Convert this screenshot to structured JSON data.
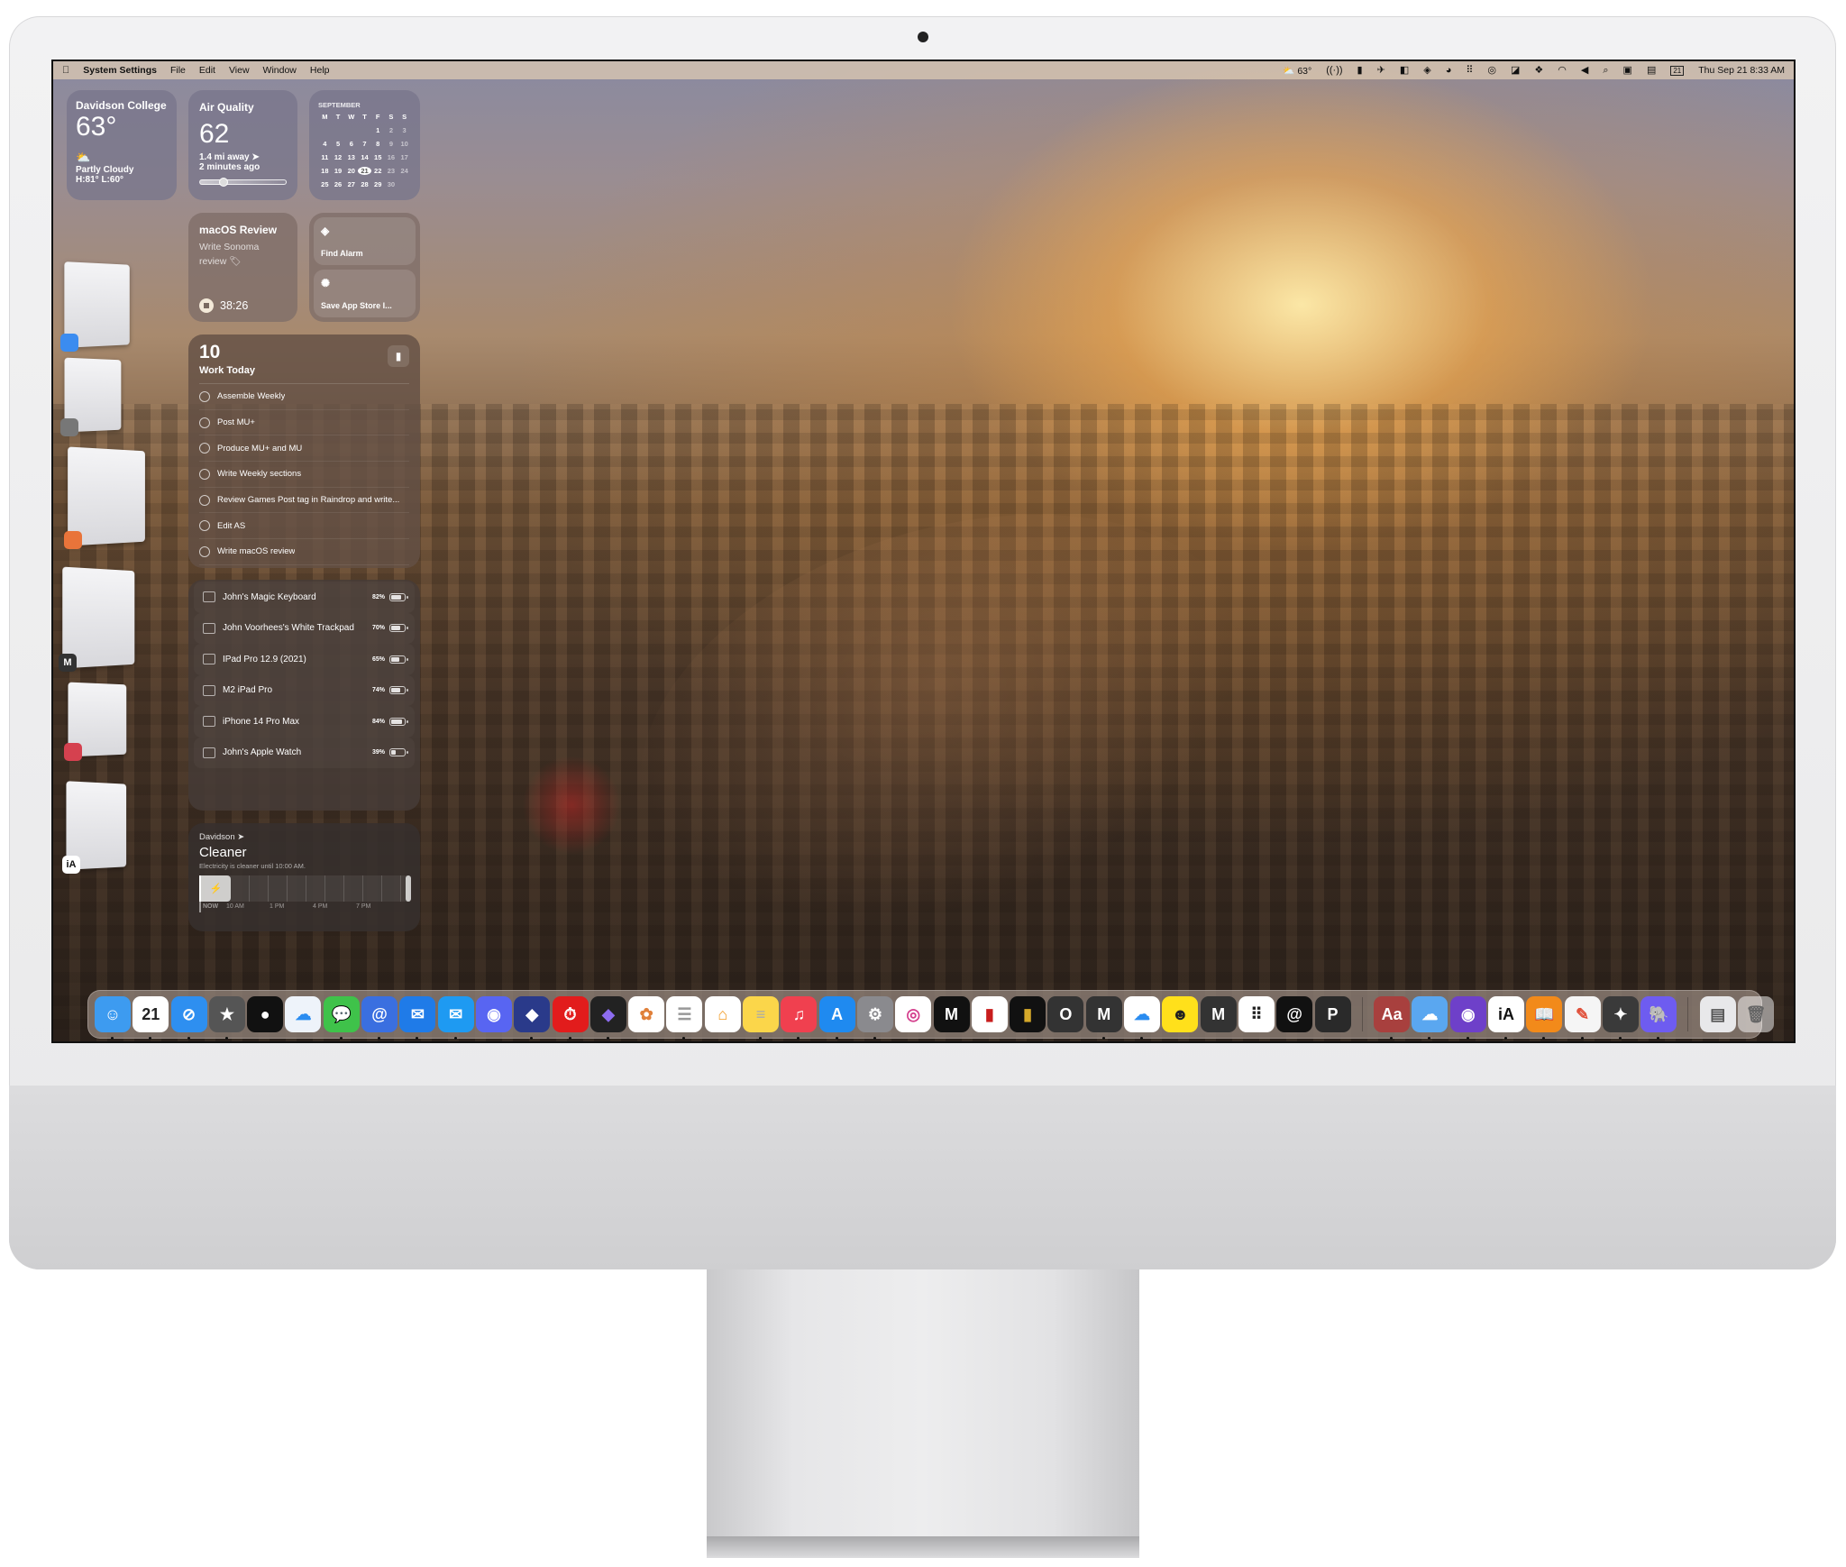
{
  "menubar": {
    "app_name": "System Settings",
    "menus": [
      "File",
      "Edit",
      "View",
      "Window",
      "Help"
    ],
    "status_icons": [
      "broadcast-icon",
      "weather-icon",
      "bookmark-icon",
      "rocket-icon",
      "sidebar-icon",
      "calendar-icon",
      "layers-icon",
      "pacman-icon",
      "grid-icon",
      "fingerprint-icon",
      "tag-icon",
      "dropbox-icon",
      "wifi-icon",
      "volume-icon",
      "search-icon",
      "control-center-icon",
      "display-icon"
    ],
    "weather_temp": "63°",
    "calendar_day": "21",
    "datetime": "Thu Sep 21  8:33 AM"
  },
  "weather": {
    "location": "Davidson College",
    "temp": "63°",
    "condition": "Partly Cloudy",
    "range": "H:81° L:60°"
  },
  "air_quality": {
    "title": "Air Quality",
    "value": "62",
    "distance": "1.4 mi away",
    "updated": "2 minutes ago",
    "level": 0.22
  },
  "calendar": {
    "month": "SEPTEMBER",
    "weekdays": [
      "M",
      "T",
      "W",
      "T",
      "F",
      "S",
      "S"
    ],
    "weeks": [
      [
        "",
        "",
        "",
        "",
        "1",
        "2",
        "3"
      ],
      [
        "4",
        "5",
        "6",
        "7",
        "8",
        "9",
        "10"
      ],
      [
        "11",
        "12",
        "13",
        "14",
        "15",
        "16",
        "17"
      ],
      [
        "18",
        "19",
        "20",
        "21",
        "22",
        "23",
        "24"
      ],
      [
        "25",
        "26",
        "27",
        "28",
        "29",
        "30",
        ""
      ]
    ],
    "today": "21"
  },
  "timer": {
    "title": "macOS Review",
    "subtitle": "Write Sonoma review",
    "elapsed": "38:26"
  },
  "shortcuts": [
    {
      "label": "Find Alarm",
      "icon": "layers-icon"
    },
    {
      "label": "Save App Store I...",
      "icon": "gear-icon"
    }
  ],
  "reminders": {
    "count": "10",
    "list": "Work Today",
    "items": [
      "Assemble Weekly",
      "Post MU+",
      "Produce MU+ and MU",
      "Write Weekly sections",
      "Review Games Post tag in Raindrop and write...",
      "Edit AS",
      "Write macOS review"
    ]
  },
  "batteries": [
    {
      "name": "John's Magic Keyboard",
      "percent": "82%",
      "level": 82,
      "icon": "keyboard-icon"
    },
    {
      "name": "John Voorhees's White Trackpad",
      "percent": "70%",
      "level": 70,
      "icon": "trackpad-icon"
    },
    {
      "name": "IPad Pro 12.9 (2021)",
      "percent": "65%",
      "level": 65,
      "icon": "ipad-icon"
    },
    {
      "name": "M2 iPad Pro",
      "percent": "74%",
      "level": 74,
      "icon": "ipad-icon"
    },
    {
      "name": "iPhone 14 Pro Max",
      "percent": "84%",
      "level": 84,
      "icon": "iphone-icon"
    },
    {
      "name": "John's Apple Watch",
      "percent": "39%",
      "level": 39,
      "icon": "watch-icon"
    }
  ],
  "clean_energy": {
    "location": "Davidson",
    "status": "Cleaner",
    "message": "Electricity is cleaner until 10:00 AM.",
    "time_labels": [
      "NOW",
      "10 AM",
      "1 PM",
      "4 PM",
      "7 PM"
    ]
  },
  "stage_manager": [
    {
      "badge": "finder-icon",
      "badge_color": "#3b8cf0"
    },
    {
      "badge": "settings-icon",
      "badge_color": "#777"
    },
    {
      "badge": "safari-icon",
      "badge_color": "#e9743a"
    },
    {
      "badge": "M",
      "badge_color": "#333"
    },
    {
      "badge": "shortcuts-icon",
      "badge_color": "#d5414f"
    },
    {
      "badge": "iA",
      "badge_color": "#fff"
    }
  ],
  "dock": {
    "apps": [
      {
        "name": "finder",
        "glyph": "☺",
        "bg": "#3d9bf0",
        "running": true
      },
      {
        "name": "calendar",
        "glyph": "21",
        "bg": "#ffffff",
        "fg": "#222",
        "running": true
      },
      {
        "name": "safari",
        "glyph": "⊘",
        "bg": "#2e8ff0",
        "running": true
      },
      {
        "name": "cloud-star",
        "glyph": "★",
        "bg": "#555",
        "running": true
      },
      {
        "name": "black-app",
        "glyph": "●",
        "bg": "#111"
      },
      {
        "name": "cloud-app",
        "glyph": "☁",
        "bg": "#eef3fa",
        "fg": "#2a8cf0"
      },
      {
        "name": "messages",
        "glyph": "💬",
        "bg": "#3fc24a",
        "running": true
      },
      {
        "name": "spark",
        "glyph": "@",
        "bg": "#3a6fe0",
        "running": true
      },
      {
        "name": "mimestream",
        "glyph": "✉",
        "bg": "#1f7be8",
        "running": true
      },
      {
        "name": "mail",
        "glyph": "✉",
        "bg": "#1e9af2",
        "running": true
      },
      {
        "name": "discord",
        "glyph": "◉",
        "bg": "#5865f2"
      },
      {
        "name": "shortcuts",
        "glyph": "◆",
        "bg": "#2a3a8a",
        "running": true
      },
      {
        "name": "timery",
        "glyph": "⏱",
        "bg": "#e21c1c",
        "running": true
      },
      {
        "name": "obsidian",
        "glyph": "◆",
        "bg": "#222",
        "fg": "#8d6cf0",
        "running": true
      },
      {
        "name": "photos",
        "glyph": "✿",
        "bg": "#ffffff",
        "fg": "#e0803a"
      },
      {
        "name": "reminders",
        "glyph": "☰",
        "bg": "#ffffff",
        "fg": "#999",
        "running": true
      },
      {
        "name": "home",
        "glyph": "⌂",
        "bg": "#ffffff",
        "fg": "#f29a22"
      },
      {
        "name": "notes",
        "glyph": "≡",
        "bg": "#fbd64a",
        "fg": "#aaa",
        "running": true
      },
      {
        "name": "music",
        "glyph": "♫",
        "bg": "#f0404f",
        "running": true
      },
      {
        "name": "app-store",
        "glyph": "A",
        "bg": "#1f8af0",
        "running": true
      },
      {
        "name": "system-settings",
        "glyph": "⚙",
        "bg": "#8a8a8e",
        "running": true
      },
      {
        "name": "instagram",
        "glyph": "◎",
        "bg": "#ffffff",
        "fg": "#d43f8d"
      },
      {
        "name": "mastodon",
        "glyph": "M",
        "bg": "#111"
      },
      {
        "name": "readwise",
        "glyph": "▮",
        "bg": "#ffffff",
        "fg": "#c81d1d"
      },
      {
        "name": "goodlinks",
        "glyph": "▮",
        "bg": "#111",
        "fg": "#d6a92a"
      },
      {
        "name": "o-app",
        "glyph": "O",
        "bg": "#333"
      },
      {
        "name": "m-app",
        "glyph": "M",
        "bg": "#333",
        "running": true
      },
      {
        "name": "icloud",
        "glyph": "☁",
        "bg": "#ffffff",
        "fg": "#2a8cf0",
        "running": true
      },
      {
        "name": "mailchimp",
        "glyph": "☻",
        "bg": "#ffe01b",
        "fg": "#222"
      },
      {
        "name": "m-app-2",
        "glyph": "M",
        "bg": "#333"
      },
      {
        "name": "launchpad",
        "glyph": "⠿",
        "bg": "#ffffff",
        "fg": "#222"
      },
      {
        "name": "threads",
        "glyph": "@",
        "bg": "#111"
      },
      {
        "name": "p-app",
        "glyph": "P",
        "bg": "#2a2a2a"
      }
    ],
    "apps2": [
      {
        "name": "dictionary",
        "glyph": "Aa",
        "bg": "#a8403e",
        "running": true
      },
      {
        "name": "weather",
        "glyph": "☁",
        "bg": "#5aa7f0",
        "running": true
      },
      {
        "name": "github",
        "glyph": "◉",
        "bg": "#6e40c9",
        "running": true
      },
      {
        "name": "ia-writer",
        "glyph": "iA",
        "bg": "#ffffff",
        "fg": "#111",
        "running": true
      },
      {
        "name": "books",
        "glyph": "📖",
        "bg": "#f28a1a",
        "running": true
      },
      {
        "name": "pixelmator",
        "glyph": "✎",
        "bg": "#f5f5f5",
        "fg": "#e0503a",
        "running": true
      },
      {
        "name": "compressor",
        "glyph": "✦",
        "bg": "#3a3a3a",
        "running": true
      },
      {
        "name": "tableplus",
        "glyph": "🐘",
        "bg": "#6e5cf0",
        "running": true
      }
    ],
    "stacks": [
      {
        "name": "downloads-stack",
        "glyph": "▤",
        "bg": "#e8e8ea",
        "fg": "#555"
      },
      {
        "name": "trash",
        "glyph": "🗑",
        "bg": "rgba(255,255,255,0.5)",
        "fg": "#666"
      }
    ]
  }
}
